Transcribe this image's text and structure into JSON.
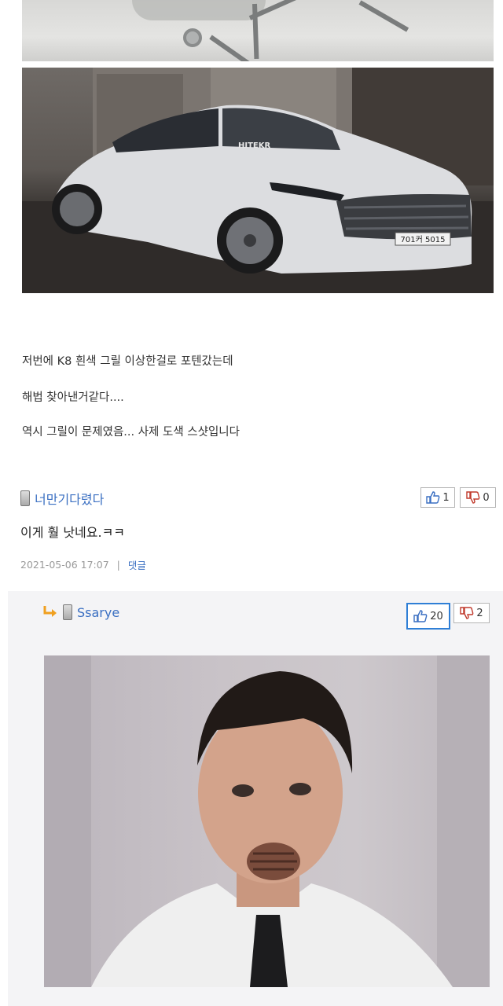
{
  "post": {
    "lines": [
      "저번에 K8 흰색 그릴 이상한걸로 포텐갔는데",
      "해법 찾아낸거같다....",
      "역시 그릴이 문제였음... 사제 도색 스샷입니다"
    ],
    "car_plate": "701커 5015",
    "car_watermark": "HITEKR"
  },
  "comments": [
    {
      "nickname": "너만기다렸다",
      "text": "이게 훨 낫네요.ㅋㅋ",
      "date": "2021-05-06 17:07",
      "reply_label": "댓글",
      "likes": "1",
      "dislikes": "0"
    },
    {
      "nickname": "Ssarye",
      "likes": "20",
      "dislikes": "2"
    }
  ],
  "colors": {
    "link": "#3a6fc2",
    "active_vote_border": "#2f7fd6",
    "like_icon": "#3a6fc2",
    "dislike_icon": "#c0392b"
  }
}
